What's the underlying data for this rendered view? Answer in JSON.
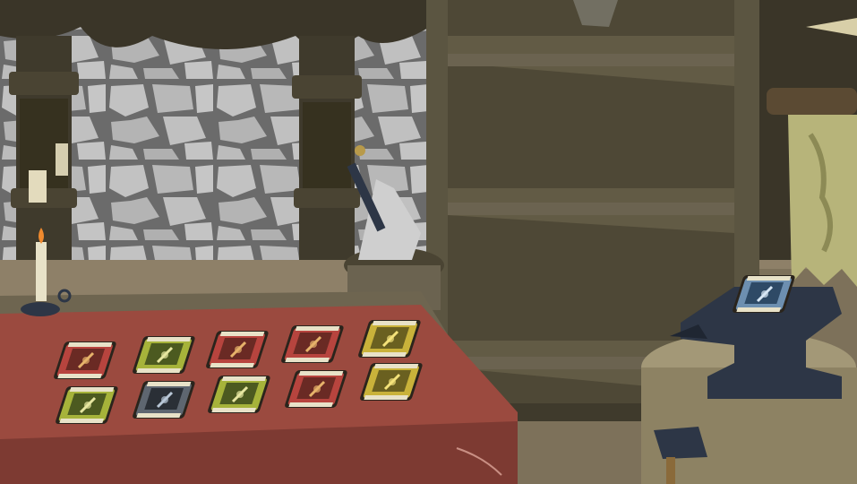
{
  "scene": {
    "name": "blacksmith-workshop",
    "colors": {
      "stone": "#bdbdbd",
      "mortar": "#6a6a6a",
      "wood_dark": "#3a3528",
      "wood_mid": "#4e4836",
      "wood_light": "#5b5541",
      "floor": "#8e8068",
      "tablecloth": "#9b4a3f",
      "tablecloth_shade": "#7d3a32",
      "banner": "#b7b47a",
      "anvil": "#2d3646",
      "stump": "#8d8263"
    }
  },
  "table_cards": [
    {
      "slot": 1,
      "row": 1,
      "variant": "red",
      "art_icon": "sword-icon"
    },
    {
      "slot": 2,
      "row": 1,
      "variant": "green",
      "art_icon": "bow-icon"
    },
    {
      "slot": 3,
      "row": 1,
      "variant": "red",
      "art_icon": "flower-icon"
    },
    {
      "slot": 4,
      "row": 1,
      "variant": "red",
      "art_icon": "creature-icon"
    },
    {
      "slot": 5,
      "row": 1,
      "variant": "yellow",
      "art_icon": "leaf-icon"
    },
    {
      "slot": 6,
      "row": 2,
      "variant": "green",
      "art_icon": "dagger-icon"
    },
    {
      "slot": 7,
      "row": 2,
      "variant": "grey",
      "art_icon": "shadow-icon"
    },
    {
      "slot": 8,
      "row": 2,
      "variant": "green",
      "art_icon": "herb-icon"
    },
    {
      "slot": 9,
      "row": 2,
      "variant": "red",
      "art_icon": "vine-icon"
    },
    {
      "slot": 10,
      "row": 2,
      "variant": "yellow",
      "art_icon": "coin-icon"
    }
  ],
  "card_palettes": {
    "red": {
      "frame": "#b7443e",
      "art": "#6a2a24",
      "accent": "#e6b26a"
    },
    "green": {
      "frame": "#a6b33a",
      "art": "#4c5a20",
      "accent": "#e6e6a0"
    },
    "yellow": {
      "frame": "#c9b23a",
      "art": "#6a6020",
      "accent": "#f4e27a"
    },
    "grey": {
      "frame": "#5e6670",
      "art": "#2a2f36",
      "accent": "#b8c6d6"
    },
    "blue": {
      "frame": "#6d8fb0",
      "art": "#2e4a66",
      "accent": "#d6e6f4"
    }
  },
  "anvil_card": {
    "variant": "blue",
    "art_icon": "rune-icon"
  }
}
